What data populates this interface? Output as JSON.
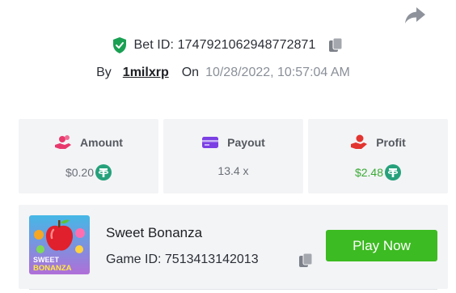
{
  "bet": {
    "id_text": "Bet ID: 1747921062948772871",
    "by_label": "By",
    "username": "1milxrp",
    "on_label": "On",
    "timestamp": "10/28/2022, 10:57:04 AM"
  },
  "stats": {
    "amount": {
      "label": "Amount",
      "value": "$0.20",
      "icon": "coins-hand-icon",
      "currency_icon": "tether-icon"
    },
    "payout": {
      "label": "Payout",
      "value": "13.4 x",
      "icon": "card-icon"
    },
    "profit": {
      "label": "Profit",
      "value": "$2.48",
      "icon": "profit-hand-icon",
      "currency_icon": "tether-icon"
    }
  },
  "game": {
    "title": "Sweet Bonanza",
    "id_text": "Game ID: 7513413142013",
    "play_label": "Play Now",
    "thumb_text_1": "SWEET",
    "thumb_text_2": "BONANZA"
  },
  "colors": {
    "verified_green": "#1aa053",
    "accent_pink": "#e8396d",
    "accent_purple": "#7b3fe4",
    "accent_red": "#e3342f",
    "tether_green": "#26a17b",
    "play_green": "#3dbb22",
    "profit_green": "#3aaa35"
  }
}
